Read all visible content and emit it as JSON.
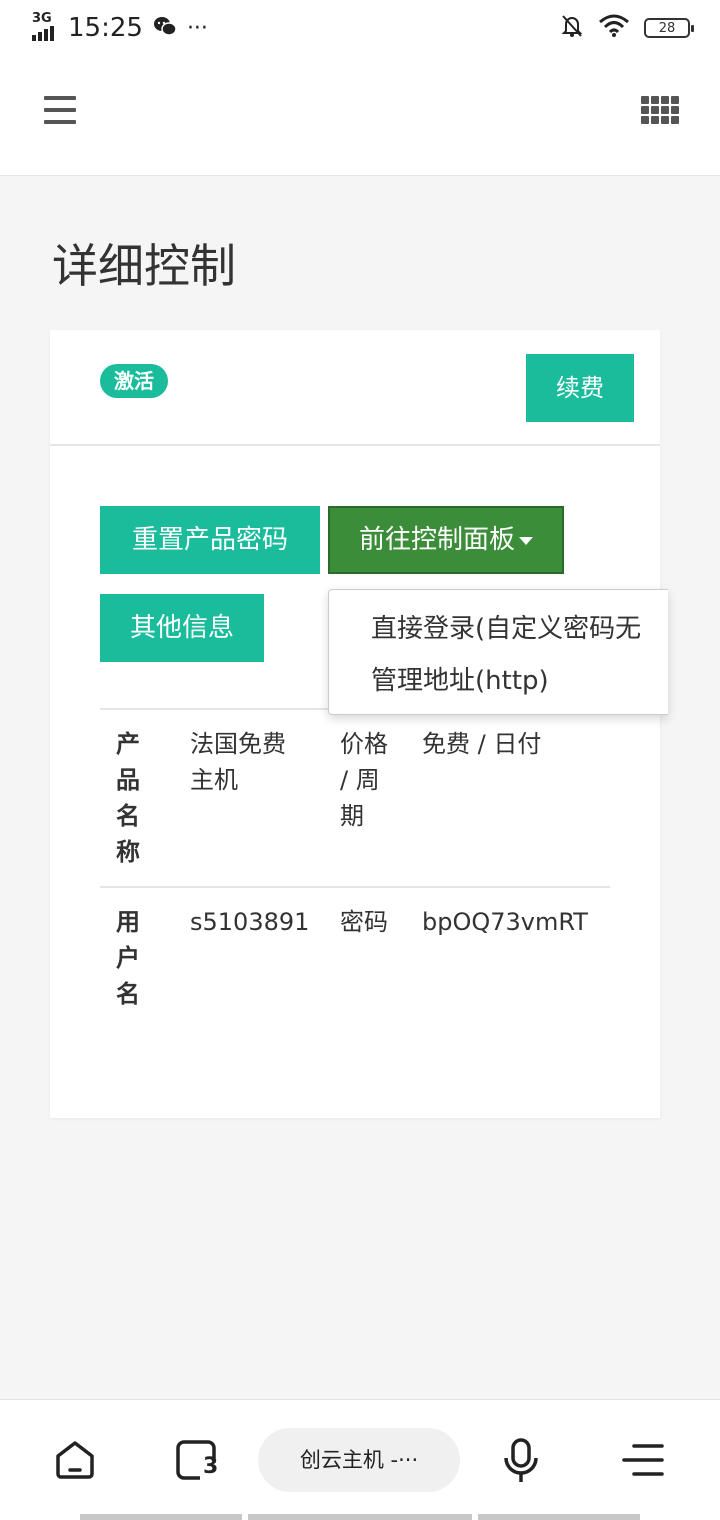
{
  "status_bar": {
    "network": "3G",
    "time": "15:25",
    "more": "···",
    "battery": "28"
  },
  "header": {
    "menu_icon": "hamburger-icon",
    "apps_icon": "grid-icon"
  },
  "page": {
    "title": "详细控制"
  },
  "card": {
    "status_badge": "激活",
    "renew_label": "续费",
    "buttons": {
      "reset_password": "重置产品密码",
      "control_panel": "前往控制面板",
      "other_info": "其他信息"
    },
    "dropdown": {
      "items": [
        "直接登录(自定义密码无",
        "管理地址(http)"
      ]
    },
    "table": {
      "rows": [
        {
          "key": "产品名称",
          "value": "法国免费主机",
          "key2": "价格 / 周期",
          "value2": "免费 / 日付"
        },
        {
          "key": "用户名",
          "value": "s5103891",
          "key2": "密码",
          "value2": "bpOQ73vmRT"
        }
      ]
    }
  },
  "bottom_nav": {
    "tab_count": "3",
    "page_label": "创云主机 -···"
  },
  "colors": {
    "accent": "#1abc9c",
    "panel_button": "#3c8d3a"
  }
}
